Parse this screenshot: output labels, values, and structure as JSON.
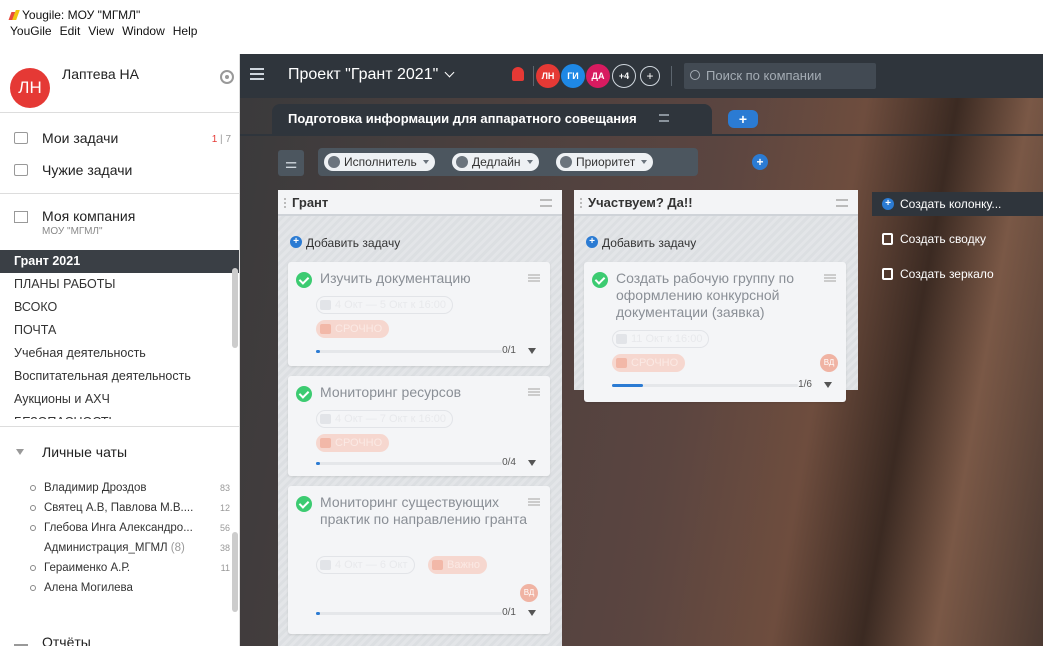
{
  "window": {
    "title": "Yougile: МОУ \"МГМЛ\"",
    "menu": [
      "YouGile",
      "Edit",
      "View",
      "Window",
      "Help"
    ]
  },
  "sidebar": {
    "user": {
      "initials": "ЛН",
      "name": "Лаптева НА"
    },
    "my_tasks": {
      "label": "Мои задачи",
      "count_new": "1",
      "count_sep": " | ",
      "count_total": "7"
    },
    "others_tasks": {
      "label": "Чужие задачи"
    },
    "company": {
      "name": "Моя компания",
      "sub": "МОУ \"МГМЛ\""
    },
    "projects": [
      "Грант 2021",
      "ПЛАНЫ РАБОТЫ",
      "ВСОКО",
      "ПОЧТА",
      "Учебная деятельность",
      "Воспитательная деятельность",
      "Аукционы и АХЧ",
      "БЕЗОПАСНОСТЬ"
    ],
    "chats_header": "Личные чаты",
    "chats": [
      {
        "name": "Владимир Дроздов",
        "count": "83"
      },
      {
        "name": "Святец А.В, Павлова М.В....",
        "count": "12"
      },
      {
        "name": "Глебова Инга Александро...",
        "count": "56"
      },
      {
        "name": "Администрация_МГМЛ",
        "suffix": " (8)",
        "count": "38"
      },
      {
        "name": "Гераименко А.Р.",
        "count": "11"
      },
      {
        "name": "Алена Могилева",
        "count": ""
      }
    ],
    "reports": "Отчёты"
  },
  "topbar": {
    "project_title": "Проект \"Грант 2021\"",
    "members": [
      {
        "initials": "ЛН",
        "color": "#e53935"
      },
      {
        "initials": "ГИ",
        "color": "#1e88e5"
      },
      {
        "initials": "ДА",
        "color": "#d81b60"
      }
    ],
    "more_members": "+4",
    "add_member": "+",
    "search_placeholder": "Поиск по компании"
  },
  "board": {
    "tab_title": "Подготовка информации для аппаратного совещания",
    "tab_add": "+",
    "filters": [
      "Исполнитель",
      "Дедлайн",
      "Приоритет"
    ],
    "filter_add": "+",
    "columns": [
      {
        "title": "Грант",
        "add_task": "Добавить задачу",
        "cards": [
          {
            "title": "Изучить документацию",
            "deadline": "4 Окт — 5 Окт к 16:00",
            "priority": "СРОЧНО",
            "progress": "0/1",
            "progress_fraction": 0.0
          },
          {
            "title": "Мониторинг ресурсов",
            "deadline": "4 Окт — 7 Окт к 16:00",
            "priority": "СРОЧНО",
            "progress": "0/4",
            "progress_fraction": 0.0
          },
          {
            "title": "Мониторинг существующих практик по направлению гранта",
            "deadline": "4 Окт — 6 Окт",
            "priority": "Важно",
            "assignee": "ВД",
            "progress": "0/1",
            "progress_fraction": 0.0
          }
        ]
      },
      {
        "title": "Участвуем? Да!!",
        "add_task": "Добавить задачу",
        "cards": [
          {
            "title": "Создать рабочую группу по оформлению конкурсной документации (заявка)",
            "deadline": "11 Окт к 16:00",
            "priority": "СРОЧНО",
            "assignee": "ВД",
            "progress": "1/6",
            "progress_fraction": 0.1667
          }
        ]
      }
    ],
    "actions": [
      "Создать колонку...",
      "Создать сводку",
      "Создать зеркало"
    ]
  }
}
